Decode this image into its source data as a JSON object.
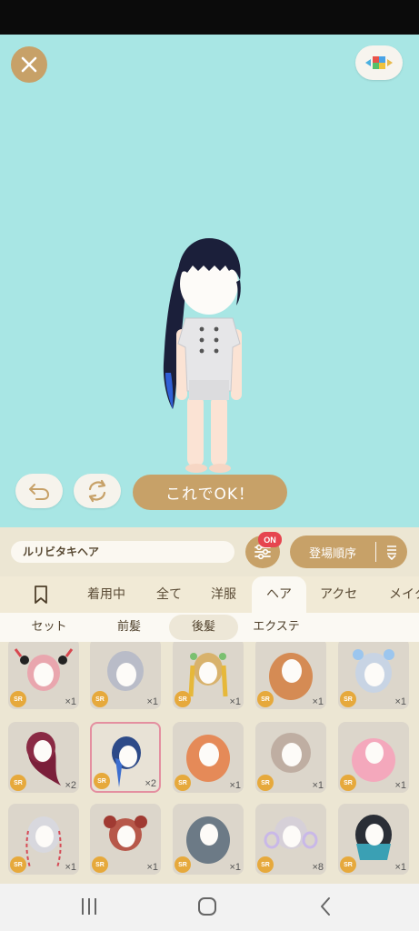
{
  "app": {
    "ok_button_label": "これでOK！",
    "name_field_value": "ルリビタキヘア",
    "filter_badge": "ON",
    "sort_label": "登場順序"
  },
  "tabs": [
    {
      "label": "着用中"
    },
    {
      "label": "全て"
    },
    {
      "label": "洋服"
    },
    {
      "label": "ヘア",
      "active": true
    },
    {
      "label": "アクセ"
    },
    {
      "label": "メイク"
    }
  ],
  "subtabs": [
    {
      "label": "セット"
    },
    {
      "label": "前髪"
    },
    {
      "label": "後髪",
      "active": true
    },
    {
      "label": "エクステ"
    }
  ],
  "items": [
    {
      "rarity": "SR",
      "count": "×1"
    },
    {
      "rarity": "SR",
      "count": "×1"
    },
    {
      "rarity": "SR",
      "count": "×1"
    },
    {
      "rarity": "SR",
      "count": "×1"
    },
    {
      "rarity": "SR",
      "count": "×1"
    },
    {
      "rarity": "SR",
      "count": "×2"
    },
    {
      "rarity": "SR",
      "count": "×2",
      "selected": true
    },
    {
      "rarity": "SR",
      "count": "×1"
    },
    {
      "rarity": "SR",
      "count": "×1"
    },
    {
      "rarity": "SR",
      "count": "×1"
    },
    {
      "rarity": "SR",
      "count": "×1"
    },
    {
      "rarity": "SR",
      "count": "×1"
    },
    {
      "rarity": "SR",
      "count": "×1"
    },
    {
      "rarity": "SR",
      "count": "×8"
    },
    {
      "rarity": "SR",
      "count": "×1"
    }
  ],
  "colors": {
    "stage_bg": "#a8e6e4",
    "accent_gold": "#c7a168",
    "badge_red": "#e6454f",
    "rarity_orange": "#e6a93c",
    "selected_border": "#e48fa0"
  },
  "icons": [
    "close-icon",
    "palette-icon",
    "undo-icon",
    "rotate-icon",
    "filter-sliders-icon",
    "sort-icon",
    "bookmark-icon",
    "nav-recent-icon",
    "nav-home-icon",
    "nav-back-icon"
  ]
}
